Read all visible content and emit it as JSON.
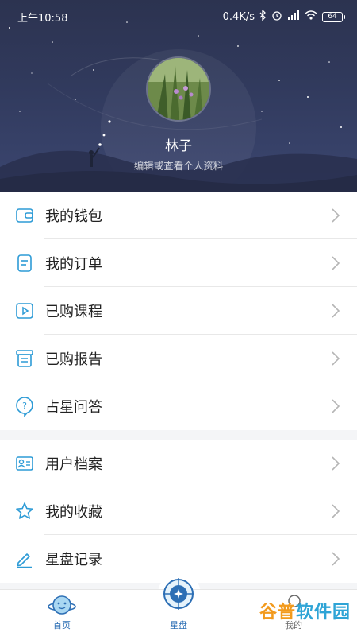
{
  "status_bar": {
    "time": "上午10:58",
    "speed": "0.4K/s",
    "battery": "64"
  },
  "profile": {
    "name": "林子",
    "edit_link": "编辑或查看个人资料"
  },
  "menu_group_1": [
    {
      "label": "我的钱包",
      "icon": "wallet-icon"
    },
    {
      "label": "我的订单",
      "icon": "order-icon"
    },
    {
      "label": "已购课程",
      "icon": "course-icon"
    },
    {
      "label": "已购报告",
      "icon": "report-icon"
    },
    {
      "label": "占星问答",
      "icon": "question-icon"
    }
  ],
  "menu_group_2": [
    {
      "label": "用户档案",
      "icon": "profile-card-icon"
    },
    {
      "label": "我的收藏",
      "icon": "star-icon"
    },
    {
      "label": "星盘记录",
      "icon": "pencil-icon"
    }
  ],
  "tabbar": {
    "home": "首页",
    "chart": "星盘",
    "partial": "我的"
  },
  "watermark": {
    "part1": "谷普",
    "part2": "软件园"
  },
  "colors": {
    "accent": "#2d9bd6",
    "header_bg": "#313a5d"
  }
}
